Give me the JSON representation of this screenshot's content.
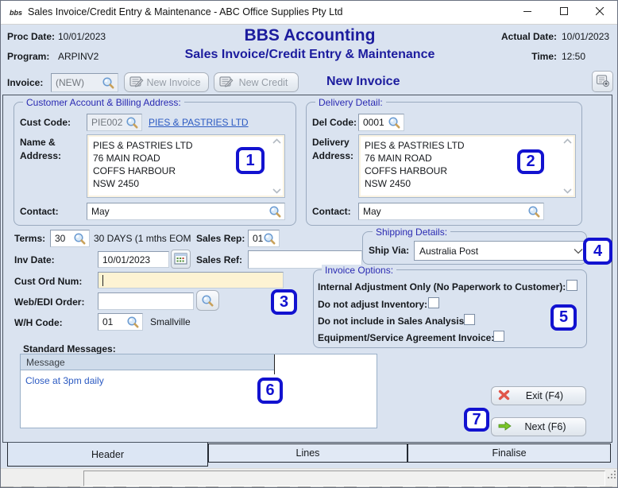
{
  "window": {
    "title": "Sales Invoice/Credit Entry & Maintenance - ABC Office Supplies Pty Ltd",
    "icon_text": "bbs"
  },
  "header": {
    "proc_date_label": "Proc Date:",
    "proc_date": "10/01/2023",
    "program_label": "Program:",
    "program": "ARPINV2",
    "title": "BBS Accounting",
    "subtitle": "Sales Invoice/Credit Entry & Maintenance",
    "actual_date_label": "Actual Date:",
    "actual_date": "10/01/2023",
    "time_label": "Time:",
    "time": "12:50"
  },
  "invoice_bar": {
    "label": "Invoice:",
    "number": "(NEW)",
    "new_invoice_button": "New Invoice",
    "new_credit_button": "New Credit",
    "status": "New Invoice"
  },
  "customer": {
    "group_title": "Customer Account & Billing Address:",
    "cust_code_label": "Cust Code:",
    "cust_code": "PIE002",
    "account_link": "PIES & PASTRIES LTD",
    "name_address_label": "Name & Address:",
    "address": "PIES & PASTRIES LTD\n76 MAIN ROAD\nCOFFS HARBOUR\nNSW 2450",
    "contact_label": "Contact:",
    "contact": "May"
  },
  "delivery": {
    "group_title": "Delivery Detail:",
    "del_code_label": "Del Code:",
    "del_code": "0001",
    "address_label": "Delivery Address:",
    "address": "PIES & PASTRIES LTD\n76 MAIN ROAD\nCOFFS HARBOUR\nNSW 2450",
    "contact_label": "Contact:",
    "contact": "May"
  },
  "details": {
    "terms_label": "Terms:",
    "terms": "30",
    "terms_desc": "30 DAYS (1 mths EOM",
    "sales_rep_label": "Sales Rep:",
    "sales_rep": "01",
    "inv_date_label": "Inv Date:",
    "inv_date": "10/01/2023",
    "sales_ref_label": "Sales Ref:",
    "sales_ref": "",
    "cust_ord_label": "Cust Ord Num:",
    "cust_ord": "",
    "web_edi_label": "Web/EDI Order:",
    "web_edi": "",
    "wh_code_label": "W/H Code:",
    "wh_code": "01",
    "wh_name": "Smallville"
  },
  "shipping": {
    "group_title": "Shipping Details:",
    "ship_via_label": "Ship Via:",
    "ship_via": "Australia Post"
  },
  "options": {
    "group_title": "Invoice Options:",
    "items": [
      {
        "label": "Internal Adjustment Only (No Paperwork to Customer):",
        "checked": false
      },
      {
        "label": "Do not adjust Inventory:",
        "checked": false
      },
      {
        "label": "Do not include in Sales Analysis:",
        "checked": false
      },
      {
        "label": "Equipment/Service Agreement Invoice:",
        "checked": false
      }
    ]
  },
  "messages": {
    "label": "Standard Messages:",
    "column_header": "Message",
    "rows": [
      "Close at 3pm daily"
    ]
  },
  "actions": {
    "exit": "Exit (F4)",
    "next": "Next (F6)"
  },
  "tabs": [
    {
      "label": "Header",
      "active": true
    },
    {
      "label": "Lines",
      "active": false
    },
    {
      "label": "Finalise",
      "active": false
    }
  ],
  "annotations": [
    "1",
    "2",
    "3",
    "4",
    "5",
    "6",
    "7"
  ],
  "colors": {
    "accent_navy": "#1c1c9e",
    "group_title_blue": "#2a2ab2",
    "link_blue": "#2b5ac2",
    "annotation_blue": "#1212d0",
    "highlight_field": "#fdf3d3",
    "table_header": "#cfdceb"
  }
}
